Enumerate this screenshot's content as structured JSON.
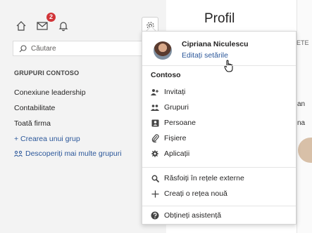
{
  "notifications": {
    "badge_count": "2"
  },
  "search": {
    "placeholder": "Căutare"
  },
  "sidebar": {
    "group_title": "GRUPURI CONTOSO",
    "items": [
      {
        "label": "Conexiune leadership"
      },
      {
        "label": "Contabilitate"
      },
      {
        "label": "Toată firma"
      }
    ],
    "create_group": "+ Crearea unui grup",
    "discover_groups": "Descoperiți mai multe grupuri"
  },
  "main": {
    "title": "Profil",
    "bg_fragments": [
      "ETE",
      "an",
      "na"
    ]
  },
  "dropdown": {
    "user_name": "Cipriana Niculescu",
    "edit_settings": "Editați setările",
    "network_name": "Contoso",
    "items": [
      {
        "label": "Invitați",
        "icon": "invite-icon"
      },
      {
        "label": "Grupuri",
        "icon": "groups-icon"
      },
      {
        "label": "Persoane",
        "icon": "people-icon"
      },
      {
        "label": "Fișiere",
        "icon": "files-icon"
      },
      {
        "label": "Aplicații",
        "icon": "apps-icon"
      }
    ],
    "network_items": [
      {
        "label": "Răsfoiți în rețele externe",
        "icon": "search-icon"
      },
      {
        "label": "Creați o rețea nouă",
        "icon": "plus-icon"
      }
    ],
    "help": {
      "label": "Obțineți asistență",
      "icon": "help-icon"
    }
  },
  "colors": {
    "accent": "#2b579a",
    "badge": "#d13438"
  }
}
